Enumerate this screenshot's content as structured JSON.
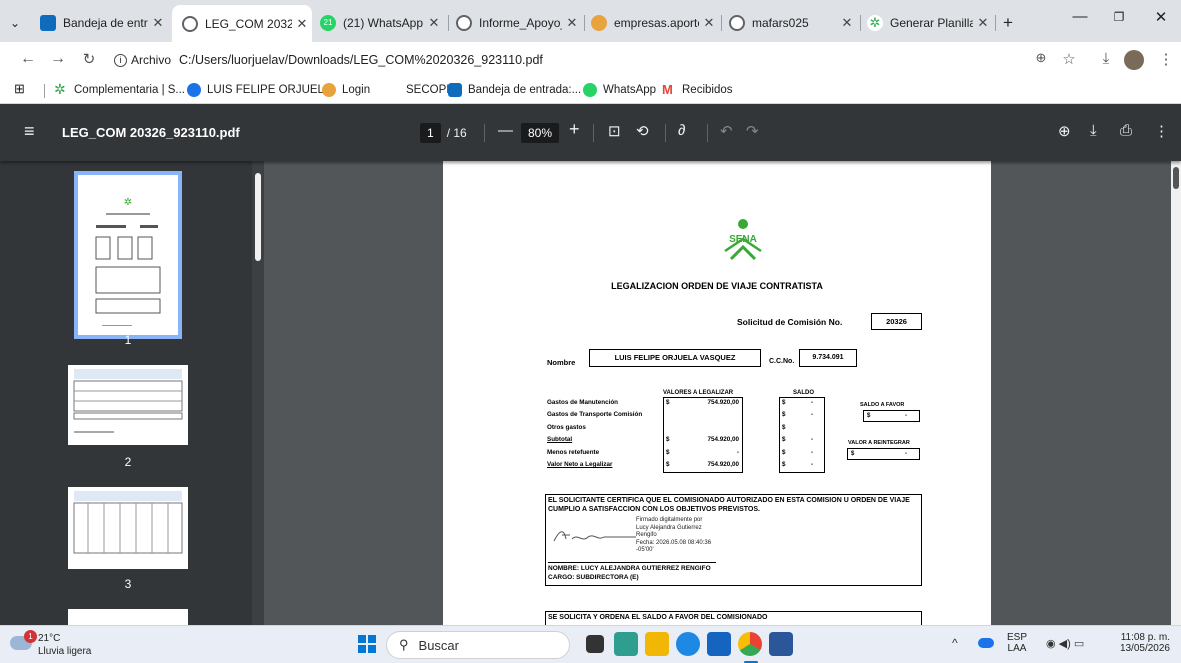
{
  "browser": {
    "tabs": [
      {
        "label": "Bandeja de entra",
        "color": "#0f6cbd"
      },
      {
        "label": "LEG_COM 20326",
        "color": "#5f6368"
      },
      {
        "label": "(21) WhatsApp",
        "color": "#25d366",
        "badge": "21"
      },
      {
        "label": "Informe_Apoyo_",
        "color": "#5f6368"
      },
      {
        "label": "empresas.aporte",
        "color": "#e8a33d"
      },
      {
        "label": "mafars025",
        "color": "#5f6368"
      },
      {
        "label": "Generar Planilla",
        "color": "#34a853"
      }
    ],
    "address": {
      "chip": "Archivo",
      "url": "C:/Users/luorjuelav/Downloads/LEG_COM%2020326_923110.pdf"
    },
    "bookmarks": [
      {
        "label": "Complementaria | S...",
        "color": "#34a853"
      },
      {
        "label": "LUIS FELIPE ORJUEL...",
        "color": "#1a73e8"
      },
      {
        "label": "Login",
        "color": "#e8a33d"
      },
      {
        "label": "SECOPII",
        "color": "#ffffff"
      },
      {
        "label": "Bandeja de entrada:...",
        "color": "#0f6cbd"
      },
      {
        "label": "WhatsApp",
        "color": "#25d366"
      },
      {
        "label": "Recibidos",
        "color": "#ea4335"
      }
    ]
  },
  "pdf": {
    "filename": "LEG_COM 20326_923110.pdf",
    "page_current": "1",
    "page_total": "/ 16",
    "zoom": "80%",
    "thumbnails": [
      "1",
      "2",
      "3"
    ]
  },
  "document": {
    "logo_text": "SENA",
    "title": "LEGALIZACION ORDEN DE VIAJE CONTRATISTA",
    "solicitud_label": "Solicitud de Comisión No.",
    "solicitud_no": "20326",
    "nombre_label": "Nombre",
    "nombre": "LUIS FELIPE ORJUELA VASQUEZ",
    "cc_label": "C.C.No.",
    "cc": "9.734.091",
    "col_legalizar": "VALORES A LEGALIZAR",
    "col_saldo": "SALDO",
    "saldo_favor_label": "SALDO A FAVOR",
    "valor_reintegrar_label": "VALOR A REINTEGRAR",
    "currency": "$",
    "dash": "-",
    "rows": [
      {
        "label": "Gastos de Manutención",
        "value": "754.920,00",
        "underline": false
      },
      {
        "label": "Gastos de Transporte Comisión",
        "value": "",
        "underline": false
      },
      {
        "label": "Otros gastos",
        "value": "",
        "underline": false
      },
      {
        "label": "Subtotal",
        "value": "754.920,00",
        "underline": true
      },
      {
        "label": "Menos retefuente",
        "value": "-",
        "underline": false
      },
      {
        "label": "Valor Neto a Legalizar",
        "value": "754.920,00",
        "underline": true
      }
    ],
    "cert_text": "EL SOLICITANTE CERTIFICA QUE EL COMISIONADO AUTORIZADO EN ESTA COMISION U ORDEN DE VIAJE CUMPLIO A SATISFACCION CON LOS OBJETIVOS PREVISTOS.",
    "signed_lines": [
      "Firmado digitalmente por",
      "Lucy Alejandra Gutierrez",
      "Rengifo",
      "Fecha: 2026.05.08 08:40:36",
      "-05'00'"
    ],
    "nombre_firma": "NOMBRE: LUCY ALEJANDRA GUTIERREZ RENGIFO",
    "cargo_firma": "CARGO: SUBDIRECTORA (E)",
    "bottom_text": "SE SOLICITA Y ORDENA  EL SALDO A FAVOR DEL COMISIONADO"
  },
  "taskbar": {
    "weather_temp": "21°C",
    "weather_desc": "Lluvia ligera",
    "weather_badge": "1",
    "search_placeholder": "Buscar",
    "lang": "ESP",
    "lang2": "LAA",
    "time": "11:08 p. m.",
    "date": "13/05/2026"
  }
}
